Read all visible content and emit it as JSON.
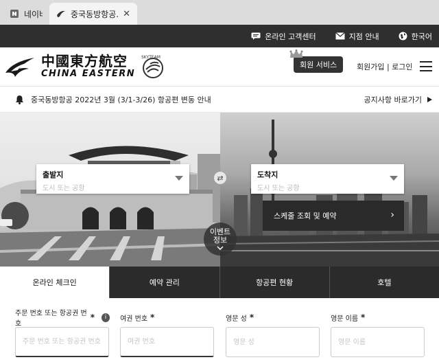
{
  "browser": {
    "tabs": [
      {
        "title": "네이버",
        "icon": "naver-favicon",
        "active": false
      },
      {
        "title": "중국동방항공...",
        "icon": "china-eastern-favicon",
        "active": true
      }
    ]
  },
  "utility": {
    "customer_center": "온라인 고객센터",
    "branches": "지점 안내",
    "language": "한국어"
  },
  "header": {
    "logo_cn": "中國東方航空",
    "logo_en": "CHINA EASTERN",
    "skyteam": "SKYTEAM",
    "member_service": "회원 서비스",
    "login": "회원가입 | 로그인"
  },
  "notice": {
    "text": "중국동방항공 2022년 3월 (3/1-3/26) 항공편 변동 안내",
    "link": "공지사항 바로가기"
  },
  "hero": {
    "departure_label": "출발지",
    "departure_placeholder": "도시 또는 공항",
    "arrival_label": "도착지",
    "arrival_placeholder": "도시 또는 공항",
    "schedule_button": "스케줄 조회 및 예약",
    "event_line1": "이벤트",
    "event_line2": "정보"
  },
  "tabs": [
    "온라인 체크인",
    "예약 관리",
    "항공편 현황",
    "호텔"
  ],
  "form": {
    "fields": [
      {
        "label": "주문 번호 또는 항공권 번호",
        "placeholder": "주문 번호 또는 항공권 번호"
      },
      {
        "label": "여권 번호",
        "placeholder": "여권 번호"
      },
      {
        "label": "영문 성",
        "placeholder": "영문 성"
      },
      {
        "label": "영문 이름",
        "placeholder": "영문 이름"
      }
    ],
    "required_mark": "*",
    "info_icon": "i"
  },
  "colors": {
    "topbar": "#2f2f2f",
    "tab_dark": "#2b2b2b",
    "button_dark": "#333333"
  }
}
